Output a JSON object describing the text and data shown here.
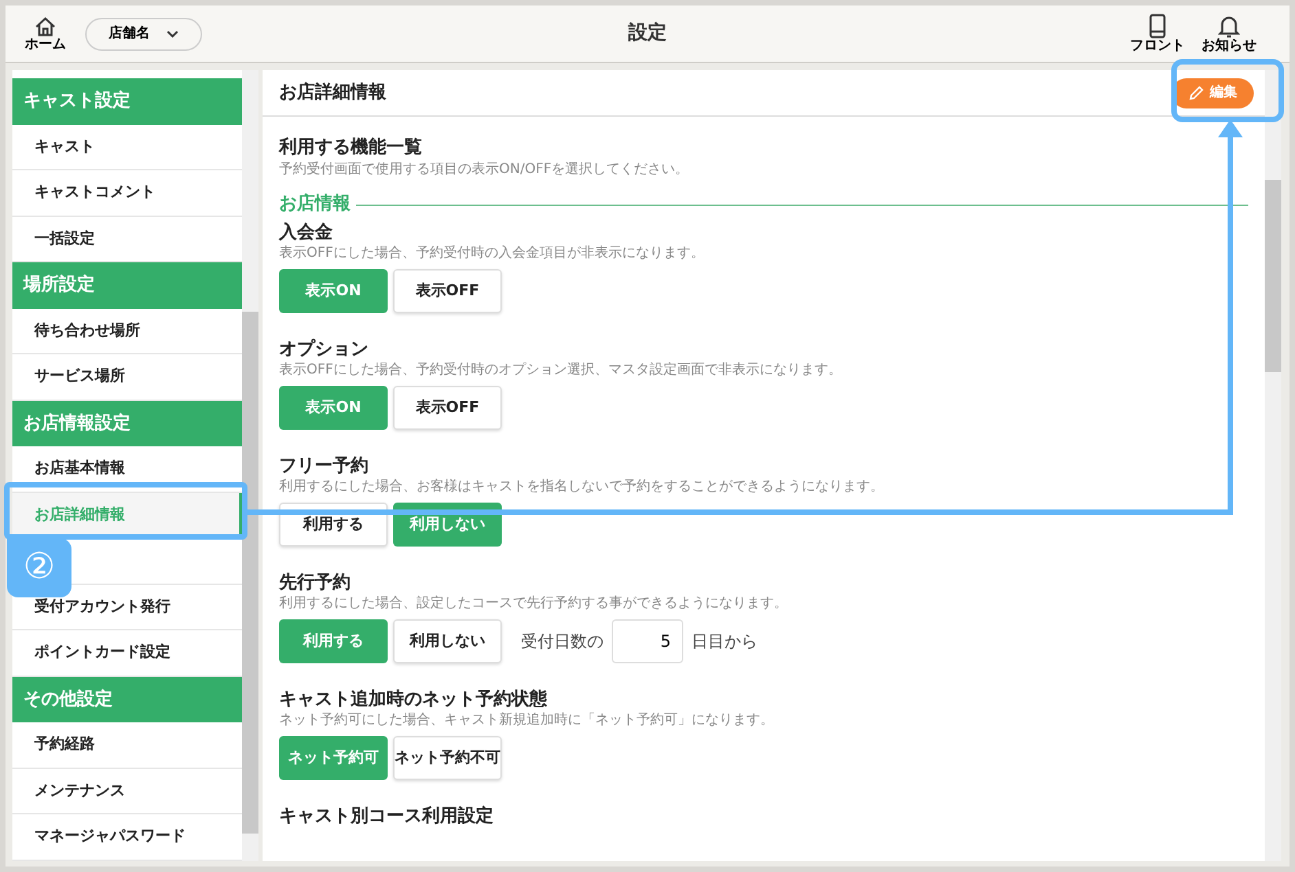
{
  "header": {
    "home_label": "ホーム",
    "store_select": "店舗名",
    "title": "設定",
    "actions": [
      {
        "kind": "phone",
        "label": "フロント"
      },
      {
        "kind": "bell",
        "label": "お知らせ"
      }
    ]
  },
  "sidebar": [
    {
      "kind": "header",
      "label": "キャスト設定"
    },
    {
      "kind": "item",
      "label": "キャスト",
      "selected": false
    },
    {
      "kind": "item",
      "label": "キャストコメント",
      "selected": false
    },
    {
      "kind": "item",
      "label": "一括設定",
      "selected": false
    },
    {
      "kind": "header",
      "label": "場所設定"
    },
    {
      "kind": "item",
      "label": "待ち合わせ場所",
      "selected": false
    },
    {
      "kind": "item",
      "label": "サービス場所",
      "selected": false
    },
    {
      "kind": "header",
      "label": "お店情報設定"
    },
    {
      "kind": "item",
      "label": "お店基本情報",
      "selected": false
    },
    {
      "kind": "item",
      "label": "お店詳細情報",
      "selected": true
    },
    {
      "kind": "covered"
    },
    {
      "kind": "item",
      "label": "受付アカウント発行",
      "selected": false
    },
    {
      "kind": "item",
      "label": "ポイントカード設定",
      "selected": false
    },
    {
      "kind": "header",
      "label": "その他設定"
    },
    {
      "kind": "item",
      "label": "予約経路",
      "selected": false
    },
    {
      "kind": "item",
      "label": "メンテナンス",
      "selected": false
    },
    {
      "kind": "item",
      "label": "マネージャパスワード",
      "selected": false
    }
  ],
  "content": {
    "title": "お店詳細情報",
    "edit_button": "編集",
    "intro": {
      "title": "利用する機能一覧",
      "description": "予約受付画面で使用する項目の表示ON/OFFを選択してください。"
    },
    "group_heading": "お店情報",
    "settings": [
      {
        "title": "入会金",
        "description": "表示OFFにした場合、予約受付時の入会金項目が非表示になります。",
        "options": [
          {
            "label": "表示ON",
            "selected": true
          },
          {
            "label": "表示OFF",
            "selected": false
          }
        ]
      },
      {
        "title": "オプション",
        "description": "表示OFFにした場合、予約受付時のオプション選択、マスタ設定画面で非表示になります。",
        "options": [
          {
            "label": "表示ON",
            "selected": true
          },
          {
            "label": "表示OFF",
            "selected": false
          }
        ]
      },
      {
        "title": "フリー予約",
        "description": "利用するにした場合、お客様はキャストを指名しないで予約をすることができるようになります。",
        "options": [
          {
            "label": "利用する",
            "selected": false
          },
          {
            "label": "利用しない",
            "selected": true
          }
        ]
      },
      {
        "title": "先行予約",
        "description": "利用するにした場合、設定したコースで先行予約する事ができるようになります。",
        "options": [
          {
            "label": "利用する",
            "selected": true
          },
          {
            "label": "利用しない",
            "selected": false
          }
        ],
        "days": {
          "before": "受付日数の",
          "value": "5",
          "after": "日目から"
        }
      },
      {
        "title": "キャスト追加時のネット予約状態",
        "description": "ネット予約可にした場合、キャスト新規追加時に「ネット予約可」になります。",
        "options": [
          {
            "label": "ネット予約可",
            "selected": true
          },
          {
            "label": "ネット予約不可",
            "selected": false
          }
        ]
      },
      {
        "title": "キャスト別コース利用設定"
      }
    ]
  },
  "annotation": {
    "step": "②"
  }
}
